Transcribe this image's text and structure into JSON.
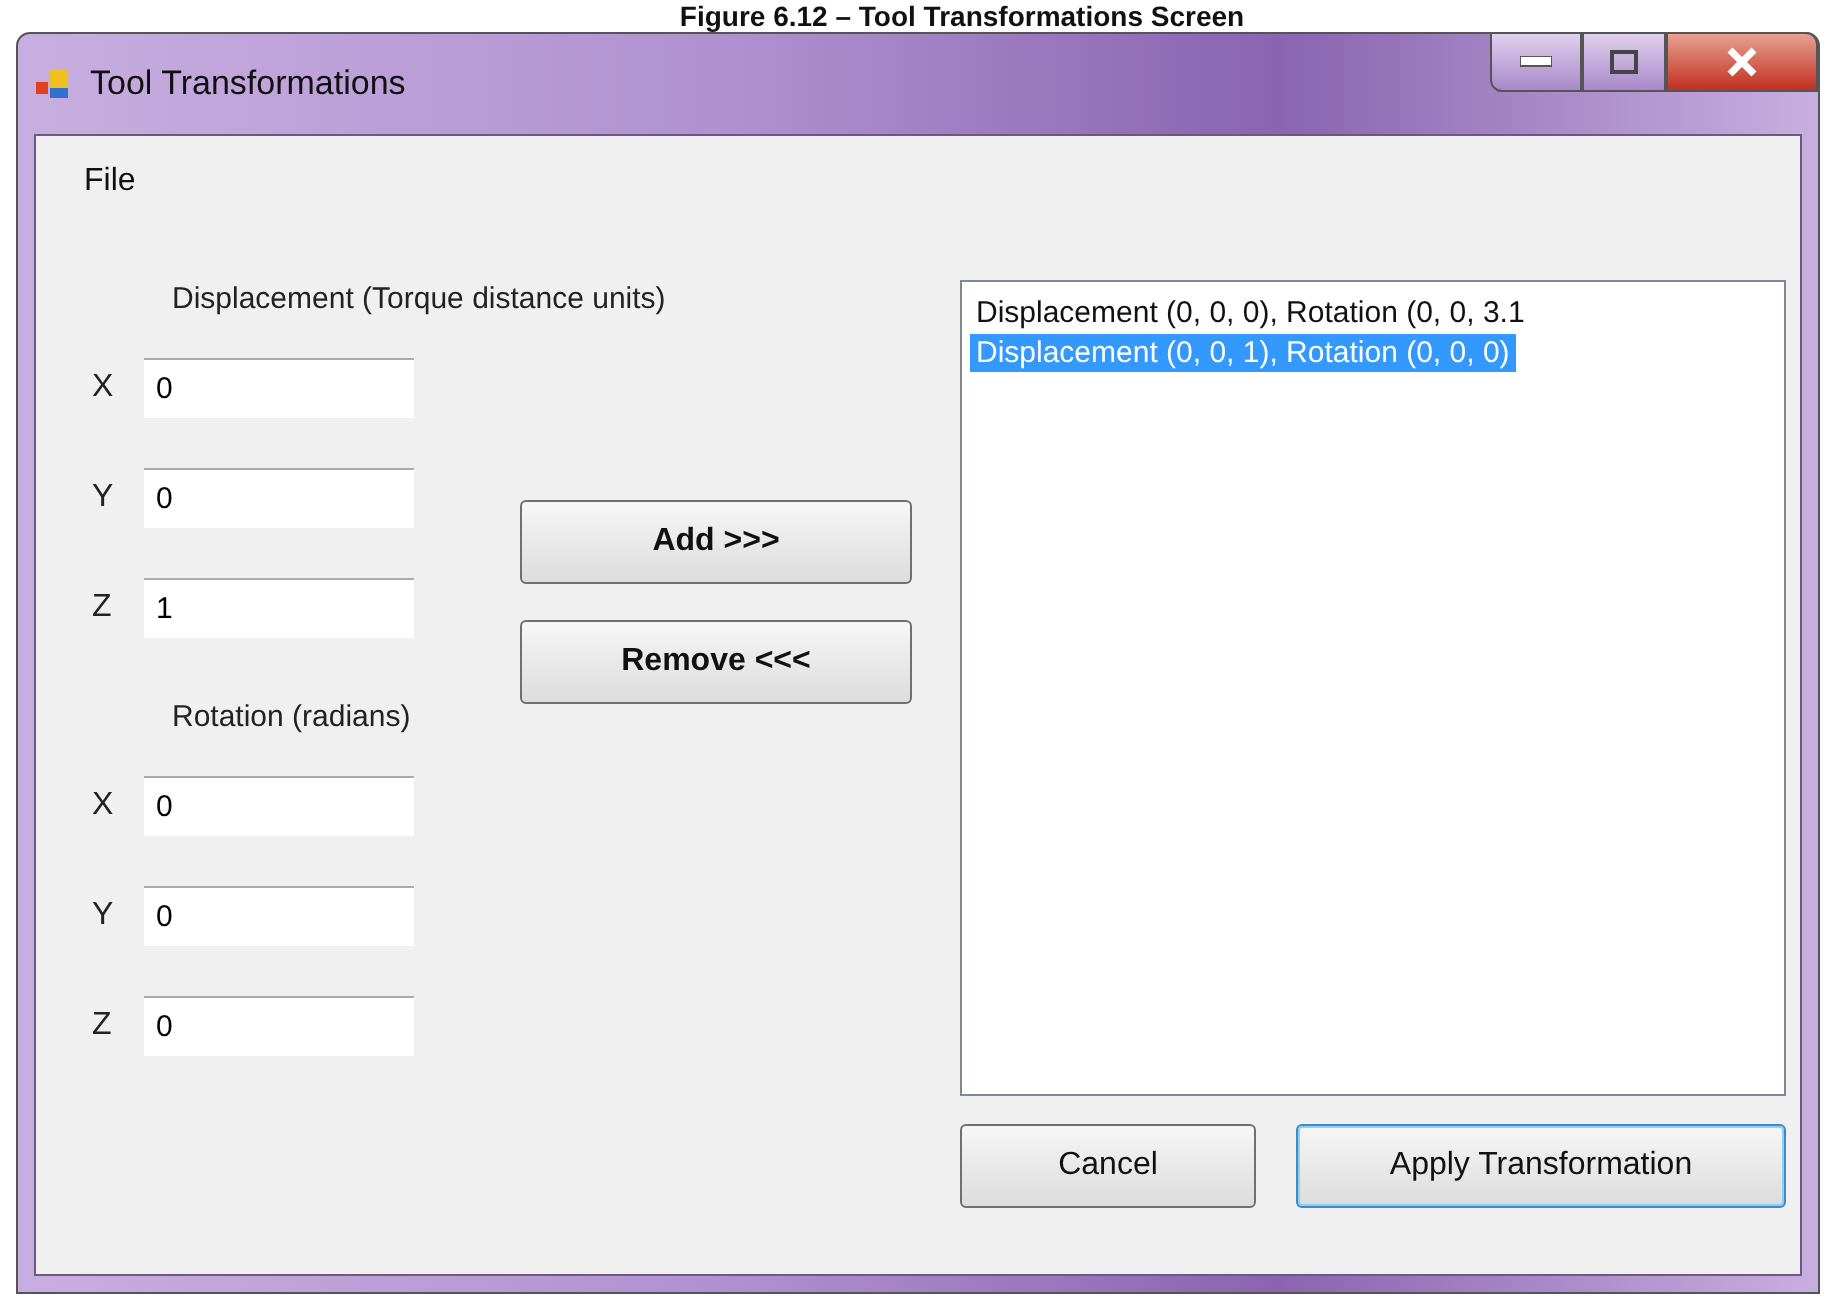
{
  "caption": "Figure 6.12 – Tool Transformations Screen",
  "window": {
    "title": "Tool Transformations"
  },
  "menu": [
    "File"
  ],
  "groups": [
    {
      "heading": "Displacement (Torque distance units)",
      "fields": [
        {
          "label": "X",
          "value": "0"
        },
        {
          "label": "Y",
          "value": "0"
        },
        {
          "label": "Z",
          "value": "1"
        }
      ]
    },
    {
      "heading": "Rotation (radians)",
      "fields": [
        {
          "label": "X",
          "value": "0"
        },
        {
          "label": "Y",
          "value": "0"
        },
        {
          "label": "Z",
          "value": "0"
        }
      ]
    }
  ],
  "middle_buttons": [
    "Add >>>",
    "Remove <<<"
  ],
  "list": [
    {
      "text": "Displacement (0, 0, 0), Rotation (0, 0, 3.1",
      "selected": false
    },
    {
      "text": "Displacement (0, 0, 1), Rotation (0, 0, 0)",
      "selected": true
    }
  ],
  "buttons": [
    {
      "label": "Cancel",
      "default": false
    },
    {
      "label": "Apply Transformation",
      "default": true
    }
  ]
}
